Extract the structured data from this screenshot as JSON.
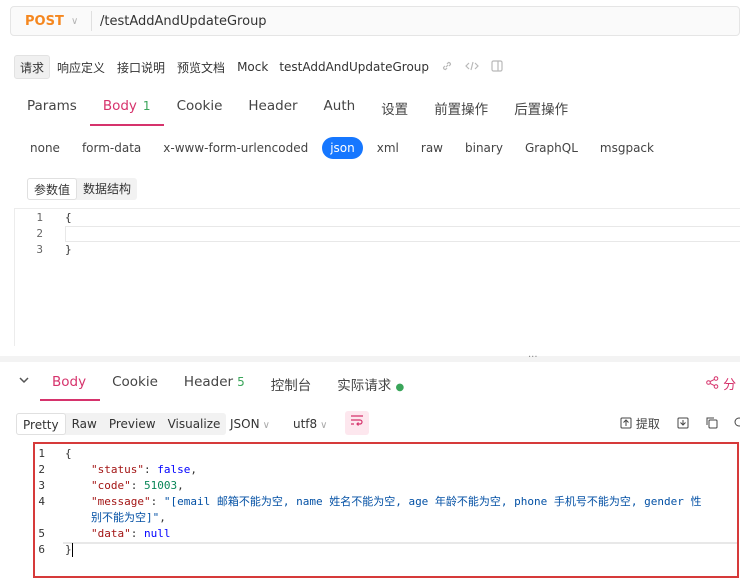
{
  "request": {
    "method": "POST",
    "url": "/testAddAndUpdateGroup"
  },
  "top_tabs": [
    {
      "label": "请求",
      "active": true
    },
    {
      "label": "响应定义",
      "active": false
    },
    {
      "label": "接口说明",
      "active": false
    },
    {
      "label": "预览文档",
      "active": false
    },
    {
      "label": "Mock",
      "active": false
    }
  ],
  "api_name": "testAddAndUpdateGroup",
  "request_tabs": [
    {
      "label": "Params",
      "badge": ""
    },
    {
      "label": "Body",
      "badge": "1"
    },
    {
      "label": "Cookie",
      "badge": ""
    },
    {
      "label": "Header",
      "badge": ""
    },
    {
      "label": "Auth",
      "badge": ""
    },
    {
      "label": "设置",
      "badge": ""
    },
    {
      "label": "前置操作",
      "badge": ""
    },
    {
      "label": "后置操作",
      "badge": ""
    }
  ],
  "body_types": [
    "none",
    "form-data",
    "x-www-form-urlencoded",
    "json",
    "xml",
    "raw",
    "binary",
    "GraphQL",
    "msgpack"
  ],
  "body_type_selected": "json",
  "param_tabs": [
    "参数值",
    "数据结构"
  ],
  "request_editor": {
    "lines": [
      {
        "n": "1",
        "text": "{"
      },
      {
        "n": "2",
        "text": ""
      },
      {
        "n": "3",
        "text": "}"
      }
    ]
  },
  "splitter_glyph": "···",
  "response_tabs": [
    {
      "label": "Body",
      "count": ""
    },
    {
      "label": "Cookie",
      "count": ""
    },
    {
      "label": "Header",
      "count": "5"
    },
    {
      "label": "控制台",
      "count": ""
    },
    {
      "label": "实际请求",
      "count": ""
    }
  ],
  "share_label": "分",
  "view_tabs": [
    "Pretty",
    "Raw",
    "Preview",
    "Visualize"
  ],
  "format_select": "JSON",
  "encoding_select": "utf8",
  "extract_label": "提取",
  "response_lines": {
    "l1": {
      "n": "1",
      "brace": "{"
    },
    "l2": {
      "n": "2",
      "key": "\"status\"",
      "value": "false",
      "tail": ","
    },
    "l3": {
      "n": "3",
      "key": "\"code\"",
      "value": "51003",
      "tail": ","
    },
    "l4": {
      "n": "4",
      "key": "\"message\"",
      "value": "\"[email 邮箱不能为空, name 姓名不能为空, age 年龄不能为空, phone 手机号不能为空, gender 性",
      "tail": ""
    },
    "l4b": {
      "n": "",
      "value": "别不能为空]\"",
      "tail": ","
    },
    "l5": {
      "n": "5",
      "key": "\"data\"",
      "value": "null",
      "tail": ""
    },
    "l6": {
      "n": "6",
      "brace": "}"
    }
  },
  "colors": {
    "method": "#f5871f",
    "active_tab": "#d6336c",
    "badge": "#3aa55a",
    "json_selected": "#1677ff",
    "highlight_border": "#d63a3a"
  }
}
